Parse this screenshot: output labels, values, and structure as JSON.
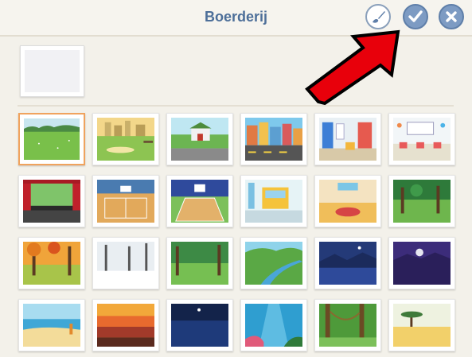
{
  "header": {
    "title": "Boerderij",
    "paint_icon": "paintbrush-icon",
    "confirm_icon": "checkmark-icon",
    "close_icon": "close-icon"
  },
  "selection": {
    "state": "empty"
  },
  "backdrops": [
    {
      "id": "field",
      "selected": true
    },
    {
      "id": "city-park"
    },
    {
      "id": "suburb-street"
    },
    {
      "id": "city-street"
    },
    {
      "id": "library"
    },
    {
      "id": "classroom"
    },
    {
      "id": "theater"
    },
    {
      "id": "gym"
    },
    {
      "id": "basketball-court"
    },
    {
      "id": "school-bus"
    },
    {
      "id": "room"
    },
    {
      "id": "forest-clearing"
    },
    {
      "id": "autumn-forest"
    },
    {
      "id": "winter-forest"
    },
    {
      "id": "woods"
    },
    {
      "id": "river"
    },
    {
      "id": "night-lake"
    },
    {
      "id": "night-purple"
    },
    {
      "id": "beach"
    },
    {
      "id": "sunset"
    },
    {
      "id": "night-sea"
    },
    {
      "id": "underwater"
    },
    {
      "id": "jungle"
    },
    {
      "id": "savanna"
    }
  ],
  "colors": {
    "accent": "#7d9bc3",
    "title": "#4d6f99",
    "selected_border": "#f0a35e",
    "arrow": "#e8000b"
  }
}
